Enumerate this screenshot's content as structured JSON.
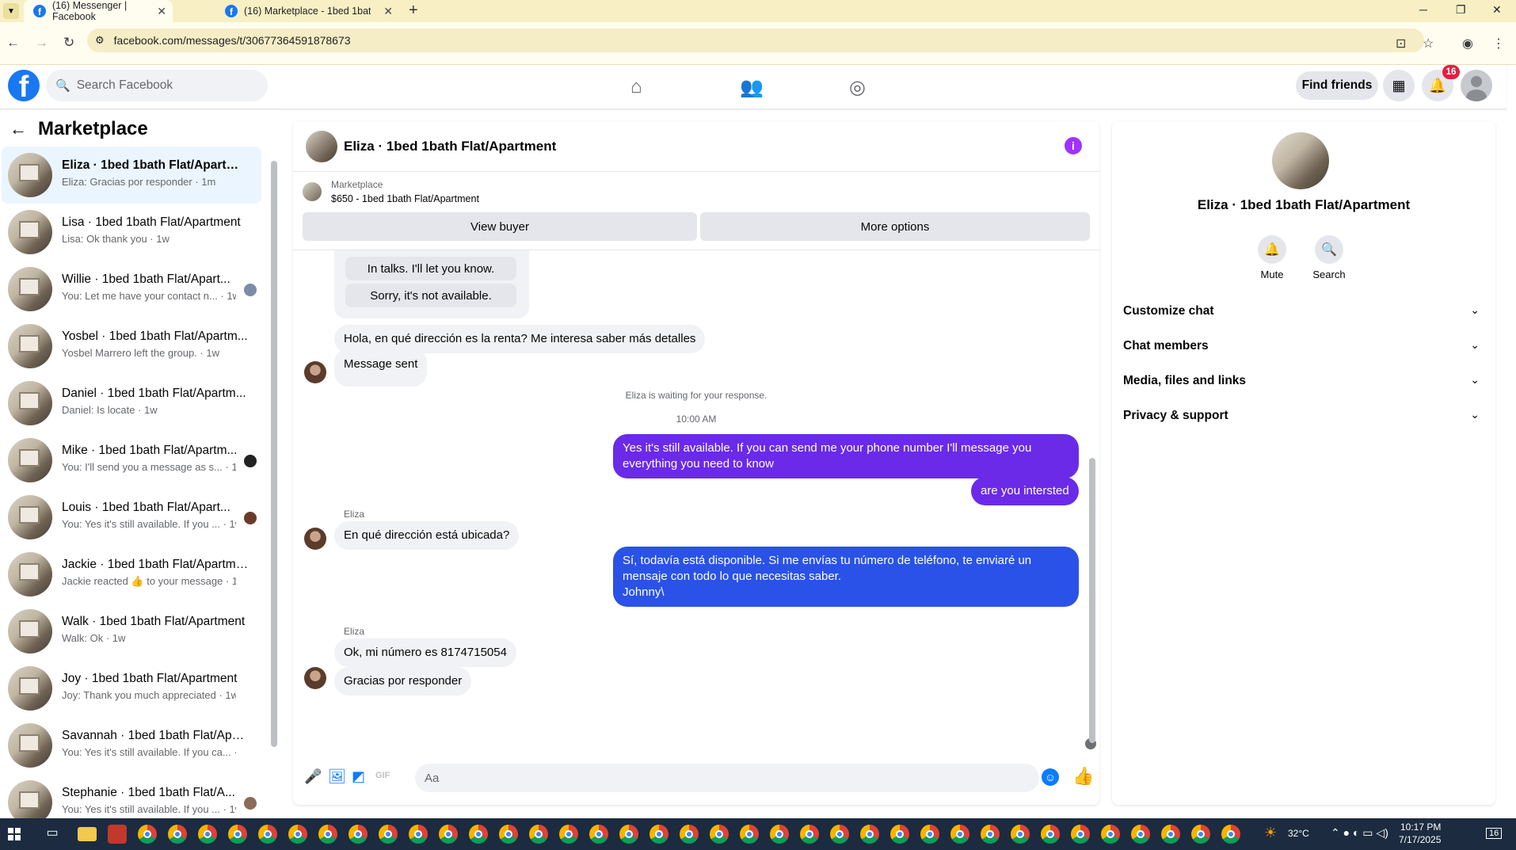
{
  "browser": {
    "tabs": [
      {
        "title": "(16) Messenger | Facebook",
        "active": true
      },
      {
        "title": "(16) Marketplace - 1bed 1bath F",
        "active": false
      }
    ],
    "url": "facebook.com/messages/t/30677364591878673"
  },
  "header": {
    "search_placeholder": "Search Facebook",
    "find_friends": "Find friends",
    "notifications_count": "16"
  },
  "sidebar": {
    "title": "Marketplace",
    "conversations": [
      {
        "name": "Eliza · 1bed 1bath Flat/Apartment",
        "preview": "Eliza: Gracias por responder · 1m",
        "active": true
      },
      {
        "name": "Lisa · 1bed 1bath Flat/Apartment",
        "preview": "Lisa: Ok thank you · 1w"
      },
      {
        "name": "Willie · 1bed 1bath Flat/Apart...",
        "preview": "You: Let me have your contact n... · 1w",
        "seen": true
      },
      {
        "name": "Yosbel · 1bed 1bath Flat/Apartm...",
        "preview": "Yosbel Marrero left the group. · 1w"
      },
      {
        "name": "Daniel · 1bed 1bath Flat/Apartm...",
        "preview": "Daniel: Is locate · 1w"
      },
      {
        "name": "Mike · 1bed 1bath Flat/Apartm...",
        "preview": "You: I'll send you a message as s... · 1w",
        "seen": true
      },
      {
        "name": "Louis · 1bed 1bath Flat/Apart...",
        "preview": "You: Yes it's still available. If you ... · 1w",
        "seen": true
      },
      {
        "name": "Jackie · 1bed 1bath Flat/Apartme...",
        "preview": "Jackie reacted 👍 to your message · 1w"
      },
      {
        "name": "Walk · 1bed 1bath Flat/Apartment",
        "preview": "Walk: Ok · 1w"
      },
      {
        "name": "Joy · 1bed 1bath Flat/Apartment",
        "preview": "Joy: Thank you much appreciated · 1w"
      },
      {
        "name": "Savannah · 1bed 1bath Flat/Apar...",
        "preview": "You: Yes it's still available. If you ca... · 1w"
      },
      {
        "name": "Stephanie · 1bed 1bath Flat/A...",
        "preview": "You: Yes it's still available. If you ... · 1w",
        "seen": true
      }
    ]
  },
  "chat": {
    "title": "Eliza · 1bed 1bath Flat/Apartment",
    "marketplace_label": "Marketplace",
    "listing": "$650 - 1bed 1bath Flat/Apartment",
    "view_buyer": "View buyer",
    "more_options": "More options",
    "quick_replies": [
      "In talks. I'll let you know.",
      "Sorry, it's not available."
    ],
    "messages": {
      "m1": "Hola, en qué dirección es la renta? Me interesa saber más detalles",
      "m2": "Message sent",
      "waiting": "Eliza is waiting for your response.",
      "time": "10:00 AM",
      "m3": "Yes it's still available. If you can send me your phone number I'll message you everything you need to know",
      "m4": "are you intersted",
      "sender1": "Eliza",
      "m5": "En qué dirección está ubicada?",
      "m6a": "Sí, todavía está disponible. Si me envías tu número de teléfono, te enviaré un mensaje con todo lo que necesitas saber.",
      "m6b": "Johnny\\",
      "sender2": "Eliza",
      "m7": "Ok, mi número es 8174715054",
      "m8": "Gracias por responder"
    },
    "composer_placeholder": "Aa"
  },
  "info_panel": {
    "name": "Eliza · 1bed 1bath Flat/Apartment",
    "mute": "Mute",
    "search": "Search",
    "sections": [
      "Customize chat",
      "Chat members",
      "Media, files and links",
      "Privacy & support"
    ]
  },
  "taskbar": {
    "temp": "32°C",
    "time": "10:17 PM",
    "date": "7/17/2025",
    "notif": "16"
  },
  "colors": {
    "fb_blue": "#1877f2",
    "outgoing_bubble": "#6a2ae8",
    "outgoing_bubble_2": "#2a52e8",
    "accent_purple": "#a033ff"
  }
}
